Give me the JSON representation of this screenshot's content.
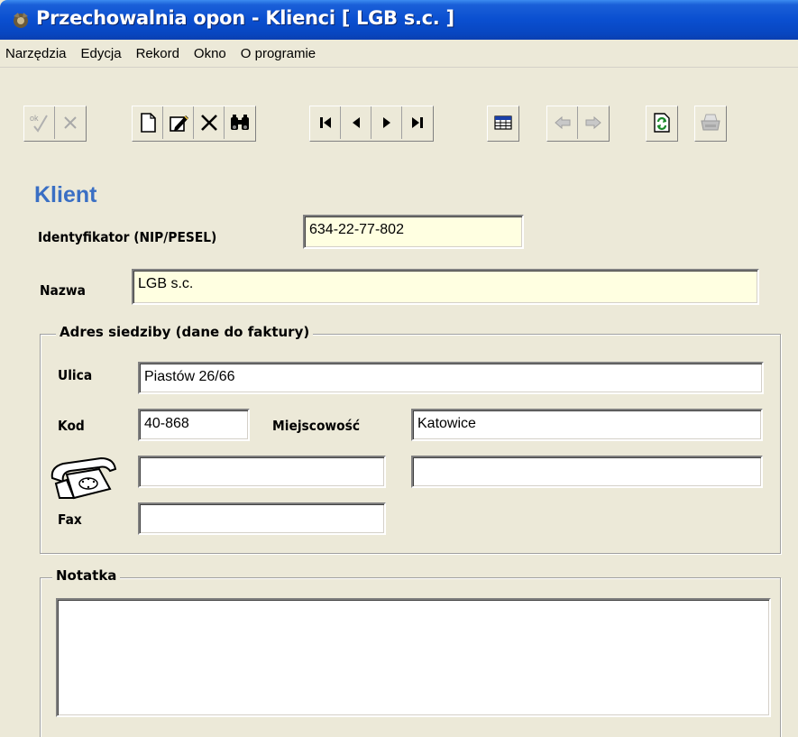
{
  "window": {
    "title": "Przechowalnia opon - Klienci [ LGB s.c. ]"
  },
  "menu": [
    "Narzędzia",
    "Edycja",
    "Rekord",
    "Okno",
    "O programie"
  ],
  "toolbar": {
    "ok_label": "ok"
  },
  "form": {
    "heading": "Klient",
    "identyfikator_label": "Identyfikator (NIP/PESEL)",
    "identyfikator_value": "634-22-77-802",
    "nazwa_label": "Nazwa",
    "nazwa_value": "LGB s.c.",
    "address_group_label": "Adres siedziby (dane do faktury)",
    "ulica_label": "Ulica",
    "ulica_value": "Piastów 26/66",
    "kod_label": "Kod",
    "kod_value": "40-868",
    "miejscowosc_label": "Miejscowość",
    "miejscowosc_value": "Katowice",
    "phone1_value": "",
    "phone2_value": "",
    "fax_label": "Fax",
    "fax_value": "",
    "notatka_label": "Notatka",
    "notatka_value": ""
  },
  "colors": {
    "title_bar": "#0a4fd0",
    "heading": "#3a6fc4",
    "field_yellow": "#ffffe1",
    "window_bg": "#ece9d8"
  }
}
